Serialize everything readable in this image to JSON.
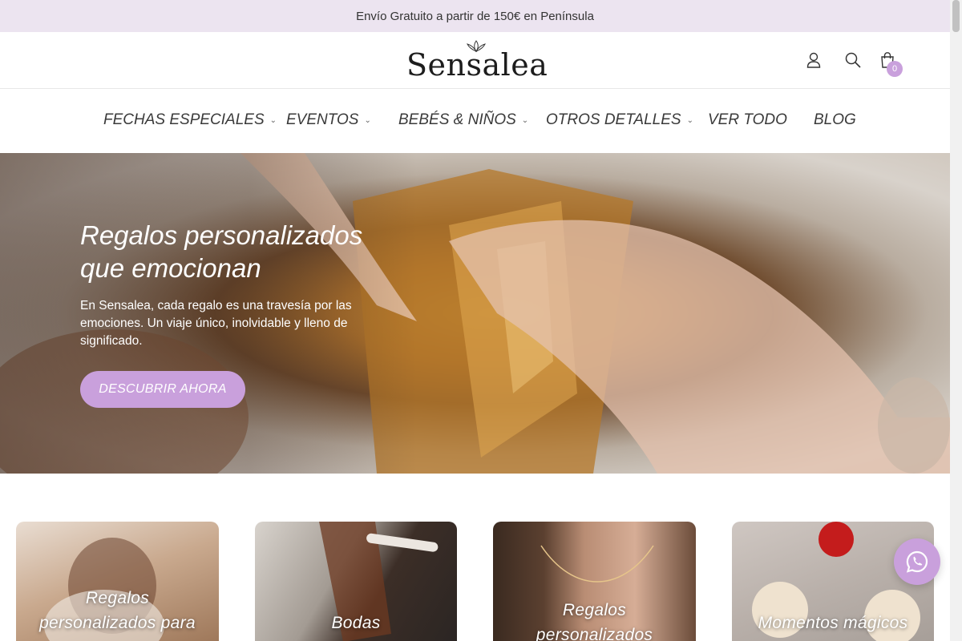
{
  "announcement": "Envío Gratuito a partir de 150€ en Península",
  "brand": {
    "logo_text": "Sensalea",
    "accent": "#c9a0dc"
  },
  "header": {
    "icons": [
      "account-icon",
      "search-icon",
      "cart-icon"
    ],
    "cart_count": "0"
  },
  "nav": {
    "items": [
      {
        "label": "FECHAS ESPECIALES",
        "has_dropdown": true
      },
      {
        "label": "EVENTOS",
        "has_dropdown": true
      },
      {
        "label": "BEBÉS & NIÑOS",
        "has_dropdown": true
      },
      {
        "label": "OTROS DETALLES",
        "has_dropdown": true
      },
      {
        "label": "VER TODO",
        "has_dropdown": false
      },
      {
        "label": "BLOG",
        "has_dropdown": false
      }
    ]
  },
  "hero": {
    "title_line1": "Regalos personalizados",
    "title_line2": "que emocionan",
    "text": "En Sensalea, cada regalo es una travesía por las emociones. Un viaje único, inolvidable y lleno de significado.",
    "button": "DESCUBRIR AHORA"
  },
  "categories": [
    {
      "line1": "Regalos",
      "line2": "personalizados para"
    },
    {
      "line1": "Bodas"
    },
    {
      "line1": "Regalos",
      "line2": "personalizados"
    },
    {
      "line1": "Momentos mágicos"
    }
  ],
  "whatsapp": {
    "icon": "whatsapp-icon"
  }
}
